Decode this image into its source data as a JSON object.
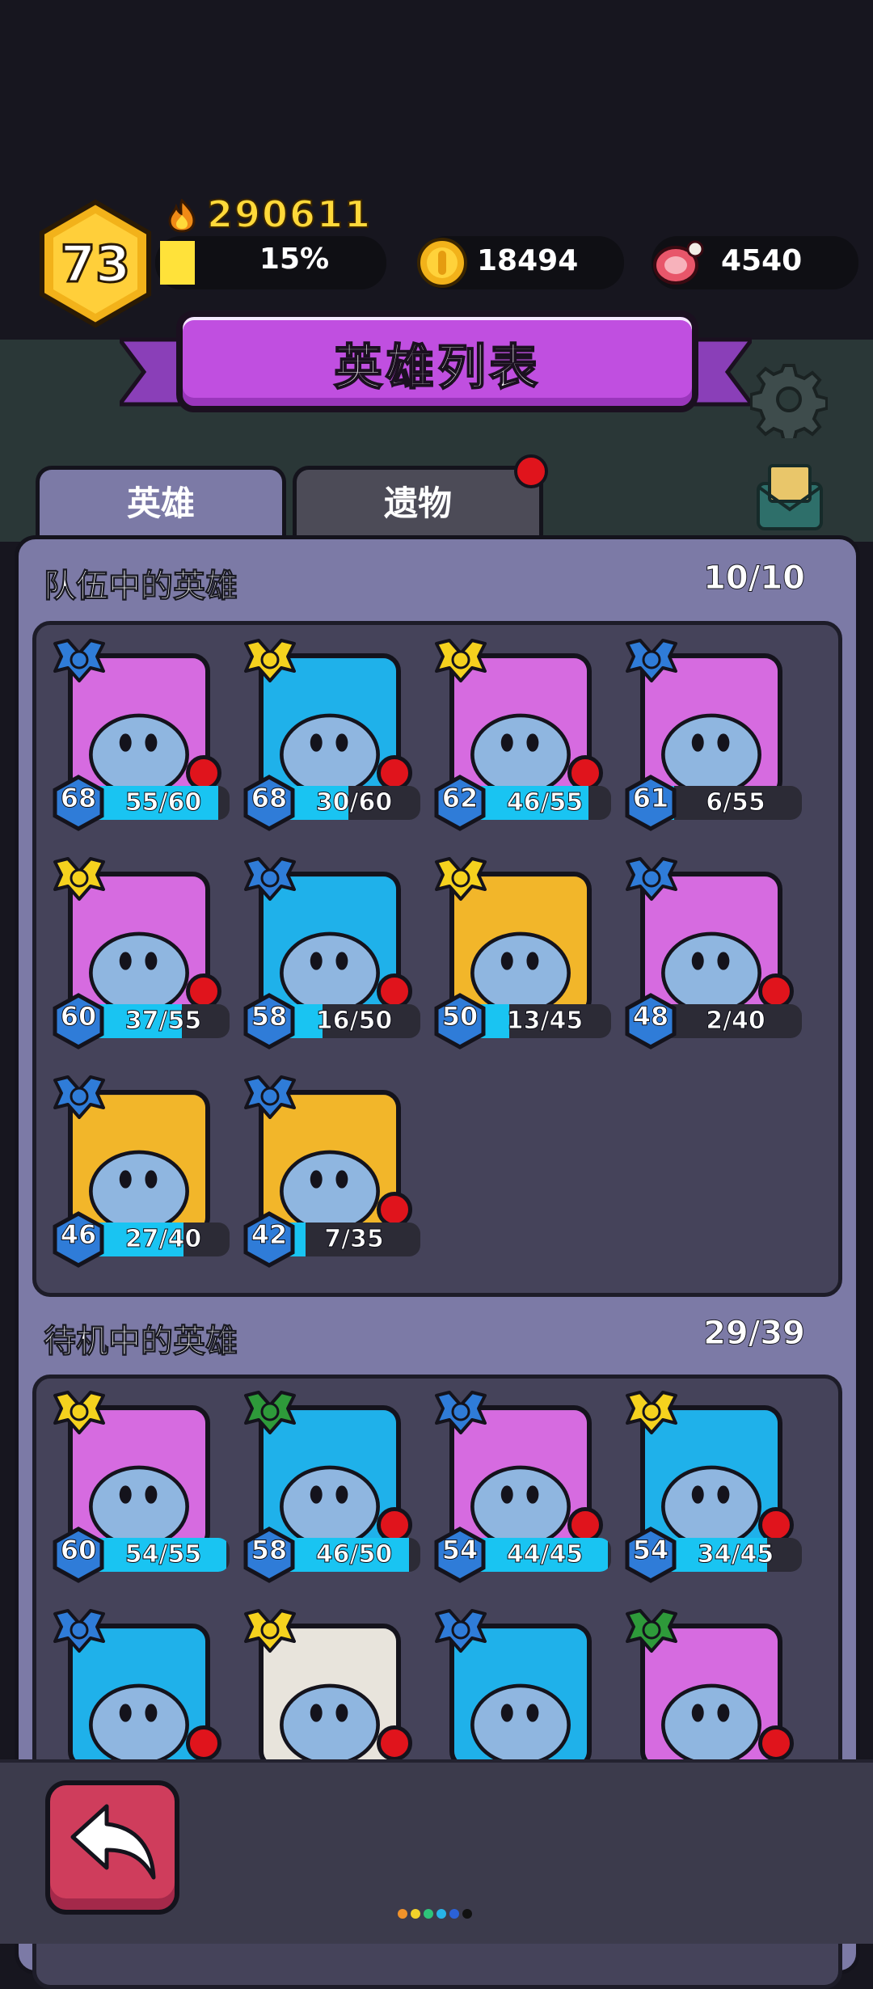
{
  "header": {
    "level": "73",
    "power": "290611",
    "xp_percent": "15%",
    "xp_fraction": 0.15,
    "gold": "18494",
    "meat": "4540"
  },
  "title": "英雄列表",
  "tabs": [
    {
      "label": "英雄",
      "active": true
    },
    {
      "label": "遗物",
      "active": false,
      "has_notification": true
    }
  ],
  "team": {
    "title": "队伍中的英雄",
    "count": "10/10",
    "heroes": [
      {
        "level": "68",
        "progress": "55/60",
        "fill": 0.917,
        "rank": "blue",
        "bg": "#d66be0",
        "icon": "tree-stump-hero-icon",
        "notify": true
      },
      {
        "level": "68",
        "progress": "30/60",
        "fill": 0.5,
        "rank": "gold",
        "bg": "#1fb1ea",
        "icon": "leaf-cat-hero-icon",
        "notify": true
      },
      {
        "level": "62",
        "progress": "46/55",
        "fill": 0.836,
        "rank": "gold",
        "bg": "#d66be0",
        "icon": "knight-helmet-hero-icon",
        "notify": true
      },
      {
        "level": "61",
        "progress": "6/55",
        "fill": 0.109,
        "rank": "blue",
        "bg": "#d66be0",
        "icon": "bunny-hero-icon",
        "notify": false
      },
      {
        "level": "60",
        "progress": "37/55",
        "fill": 0.673,
        "rank": "gold",
        "bg": "#d66be0",
        "icon": "ninja-hood-hero-icon",
        "notify": true
      },
      {
        "level": "58",
        "progress": "16/50",
        "fill": 0.32,
        "rank": "blue",
        "bg": "#1fb1ea",
        "icon": "snowman-hero-icon",
        "notify": true
      },
      {
        "level": "50",
        "progress": "13/45",
        "fill": 0.289,
        "rank": "gold",
        "bg": "#f2b62a",
        "icon": "pope-hat-hero-icon",
        "notify": false
      },
      {
        "level": "48",
        "progress": "2/40",
        "fill": 0.05,
        "rank": "blue",
        "bg": "#d66be0",
        "icon": "mummy-hero-icon",
        "notify": true
      },
      {
        "level": "46",
        "progress": "27/40",
        "fill": 0.675,
        "rank": "blue",
        "bg": "#f2b62a",
        "icon": "hermit-crab-hero-icon",
        "notify": false
      },
      {
        "level": "42",
        "progress": "7/35",
        "fill": 0.2,
        "rank": "blue",
        "bg": "#f2b62a",
        "icon": "wizard-hat-hero-icon",
        "notify": true
      }
    ]
  },
  "reserve": {
    "title": "待机中的英雄",
    "count": "29/39",
    "heroes": [
      {
        "level": "60",
        "progress": "54/55",
        "fill": 0.98,
        "rank": "gold",
        "bg": "#d66be0",
        "icon": "skull-hat-hero-icon",
        "notify": false
      },
      {
        "level": "58",
        "progress": "46/50",
        "fill": 0.92,
        "rank": "green",
        "bg": "#1fb1ea",
        "icon": "robot-hero-icon",
        "notify": true
      },
      {
        "level": "54",
        "progress": "44/45",
        "fill": 0.98,
        "rank": "blue",
        "bg": "#d66be0",
        "icon": "dino-hero-icon",
        "notify": true
      },
      {
        "level": "54",
        "progress": "34/45",
        "fill": 0.756,
        "rank": "gold",
        "bg": "#1fb1ea",
        "icon": "samurai-hero-icon",
        "notify": true
      },
      {
        "level": "",
        "progress": "",
        "fill": 0,
        "rank": "blue",
        "bg": "#1fb1ea",
        "icon": "spike-helmet-hero-icon",
        "notify": true
      },
      {
        "level": "",
        "progress": "",
        "fill": 0,
        "rank": "gold",
        "bg": "#e8e4dc",
        "icon": "viking-helmet-hero-icon",
        "notify": true
      },
      {
        "level": "",
        "progress": "",
        "fill": 0,
        "rank": "blue",
        "bg": "#1fb1ea",
        "icon": "cloud-hero-icon",
        "notify": false
      },
      {
        "level": "",
        "progress": "",
        "fill": 0,
        "rank": "green",
        "bg": "#d66be0",
        "icon": "mech-hero-icon",
        "notify": true
      }
    ]
  },
  "colors": {
    "panel": "#7c7aa6",
    "grid": "#45435a",
    "xp_bar": "#19c4f2",
    "title_banner": "#c04fe0",
    "back_button": "#cf3d5c",
    "rank_blue": "#2f7cd8",
    "rank_gold": "#f5d21e",
    "rank_green": "#2e9a3a"
  },
  "page_dots": [
    "#f0922a",
    "#f2d22a",
    "#2ec47a",
    "#27b4e8",
    "#2b62d8",
    "#111111"
  ]
}
